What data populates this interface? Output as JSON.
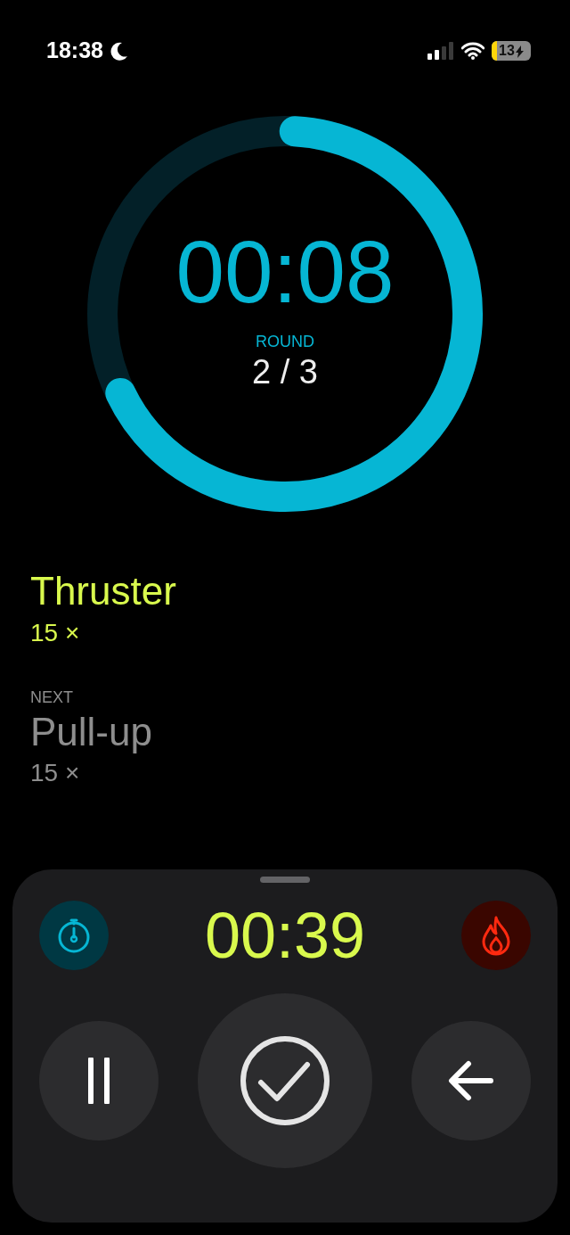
{
  "status_bar": {
    "time": "18:38",
    "focus_mode": true,
    "battery": "13",
    "charging": true
  },
  "timer": {
    "time": "00:08",
    "round_label": "ROUND",
    "round": "2 / 3"
  },
  "current_exercise": {
    "name": "Thruster",
    "reps": "15 ×"
  },
  "next_exercise": {
    "label": "NEXT",
    "name": "Pull-up",
    "reps": "15 ×"
  },
  "panel": {
    "total_time": "00:39",
    "buttons": [
      {
        "kind": "pause"
      },
      {
        "kind": "done"
      },
      {
        "kind": "back"
      }
    ]
  }
}
